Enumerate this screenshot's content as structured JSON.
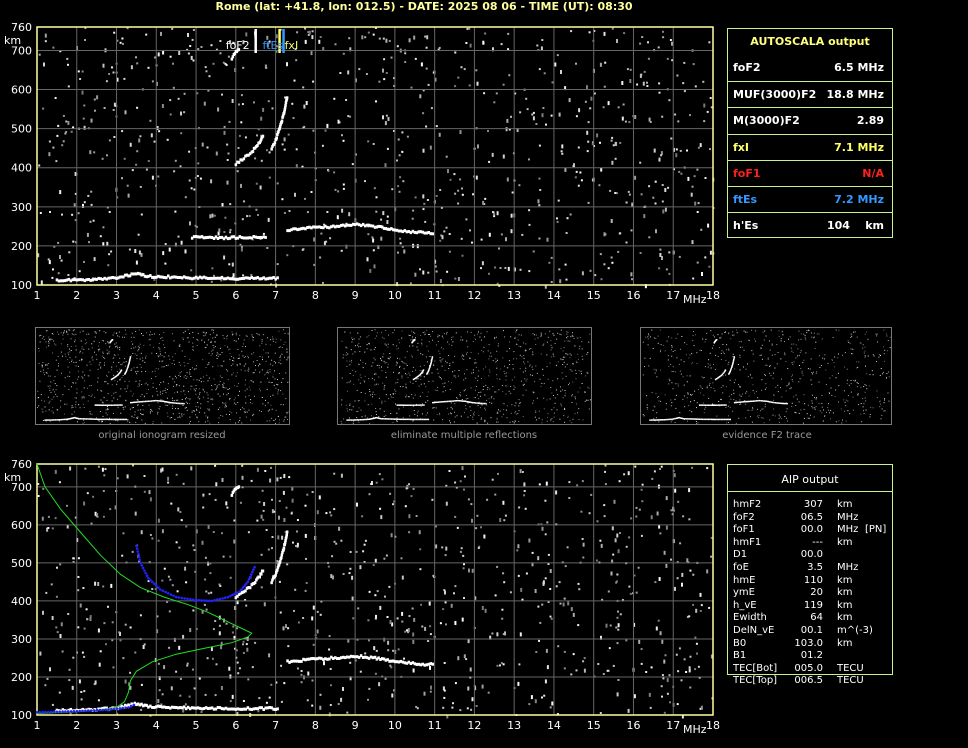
{
  "header": {
    "title": "Rome (lat: +41.8, lon: 012.5) - DATE: 2025 08 06 - TIME (UT): 08:30"
  },
  "autoscala": {
    "title": "AUTOSCALA output",
    "rows": [
      {
        "key": "foF2",
        "value": "6.5 MHz",
        "color": "#ffffff"
      },
      {
        "key": "MUF(3000)F2",
        "value": "18.8 MHz",
        "color": "#ffffff"
      },
      {
        "key": "M(3000)F2",
        "value": "2.89",
        "color": "#ffffff"
      },
      {
        "key": "fxI",
        "value": "7.1 MHz",
        "color": "#ffff66"
      },
      {
        "key": "foF1",
        "value": "N/A",
        "color": "#ff2020"
      },
      {
        "key": "ftEs",
        "value": "7.2 MHz",
        "color": "#3399ff"
      },
      {
        "key": "h'Es",
        "value": "104    km",
        "color": "#ffffff"
      }
    ]
  },
  "aip": {
    "title": "AIP output",
    "rows": [
      {
        "k": "hmF2",
        "v": "307",
        "u": "km",
        "x": ""
      },
      {
        "k": "foF2",
        "v": "06.5",
        "u": "MHz",
        "x": ""
      },
      {
        "k": "foF1",
        "v": "00.0",
        "u": "MHz",
        "x": "[PN]"
      },
      {
        "k": "hmF1",
        "v": "---",
        "u": "km",
        "x": ""
      },
      {
        "k": "D1",
        "v": "00.0",
        "u": "",
        "x": ""
      },
      {
        "k": "foE",
        "v": "3.5",
        "u": "MHz",
        "x": ""
      },
      {
        "k": "hmE",
        "v": "110",
        "u": "km",
        "x": ""
      },
      {
        "k": "ymE",
        "v": "20",
        "u": "km",
        "x": ""
      },
      {
        "k": "h_vE",
        "v": "119",
        "u": "km",
        "x": ""
      },
      {
        "k": "Ewidth",
        "v": "64",
        "u": "km",
        "x": ""
      },
      {
        "k": "DelN_vE",
        "v": "00.1",
        "u": "m^(-3)",
        "x": ""
      },
      {
        "k": "B0",
        "v": "103.0",
        "u": "km",
        "x": ""
      },
      {
        "k": "B1",
        "v": "01.2",
        "u": "",
        "x": ""
      },
      {
        "k": "TEC[Bot]",
        "v": "005.0",
        "u": "TECU",
        "x": ""
      },
      {
        "k": "TEC[Top]",
        "v": "006.5",
        "u": "TECU",
        "x": ""
      }
    ]
  },
  "thumbnails": [
    {
      "caption": "original ionogram resized"
    },
    {
      "caption": "eliminate multiple reflections"
    },
    {
      "caption": "evidence F2 trace"
    }
  ],
  "chart_data": [
    {
      "type": "scatter",
      "xlabel": "MHz",
      "ylabel": "km",
      "xlim": [
        1,
        18
      ],
      "ylim": [
        100,
        760
      ],
      "xticks": [
        "1",
        "2",
        "3",
        "4",
        "5",
        "6",
        "7",
        "8",
        "9",
        "10",
        "11",
        "12",
        "13",
        "14",
        "15",
        "16",
        "17",
        "18"
      ],
      "yticks": [
        "100",
        "200",
        "300",
        "400",
        "500",
        "600",
        "700",
        "760"
      ],
      "grid": true,
      "markers": [
        {
          "name": "foF2",
          "x": 6.5,
          "color": "#ffffff"
        },
        {
          "name": "ftEs",
          "x": 7.2,
          "color": "#3399ff"
        },
        {
          "name": "fxI",
          "x": 7.1,
          "color": "#ffff66"
        }
      ],
      "traces": [
        {
          "name": "E/Es",
          "points": [
            [
              1.5,
              112
            ],
            [
              2,
              113
            ],
            [
              2.5,
              115
            ],
            [
              3,
              118
            ],
            [
              3.3,
              125
            ],
            [
              3.5,
              130
            ],
            [
              3.8,
              122
            ],
            [
              4.5,
              120
            ],
            [
              5,
              118
            ],
            [
              6,
              117
            ],
            [
              7.1,
              117
            ]
          ]
        },
        {
          "name": "Es2",
          "points": [
            [
              4.9,
              222
            ],
            [
              5.5,
              221
            ],
            [
              6,
              221
            ],
            [
              6.8,
              223
            ]
          ]
        },
        {
          "name": "F2o",
          "points": [
            [
              6,
              410
            ],
            [
              6.2,
              425
            ],
            [
              6.4,
              440
            ],
            [
              6.6,
              465
            ],
            [
              6.7,
              485
            ]
          ]
        },
        {
          "name": "F2x",
          "points": [
            [
              6.9,
              450
            ],
            [
              7.0,
              470
            ],
            [
              7.1,
              500
            ],
            [
              7.2,
              535
            ],
            [
              7.3,
              585
            ]
          ]
        },
        {
          "name": "F2top",
          "points": [
            [
              5.9,
              680
            ],
            [
              6.0,
              695
            ],
            [
              6.1,
              705
            ]
          ]
        },
        {
          "name": "Esmulti",
          "points": [
            [
              7.3,
              240
            ],
            [
              7.8,
              245
            ],
            [
              8.5,
              250
            ],
            [
              9,
              255
            ],
            [
              9.5,
              250
            ],
            [
              10,
              240
            ],
            [
              10.5,
              235
            ],
            [
              11,
              232
            ]
          ]
        }
      ]
    },
    {
      "type": "line",
      "xlabel": "MHz",
      "ylabel": "km",
      "xlim": [
        1,
        18
      ],
      "ylim": [
        100,
        760
      ],
      "xticks": [
        "1",
        "2",
        "3",
        "4",
        "5",
        "6",
        "7",
        "8",
        "9",
        "10",
        "11",
        "12",
        "13",
        "14",
        "15",
        "16",
        "17",
        "18"
      ],
      "yticks": [
        "100",
        "200",
        "300",
        "400",
        "500",
        "600",
        "700",
        "760"
      ],
      "grid": true,
      "series": [
        {
          "name": "profile",
          "color": "#22dd22",
          "points": [
            [
              1.0,
              760
            ],
            [
              1.2,
              700
            ],
            [
              1.6,
              640
            ],
            [
              2.1,
              580
            ],
            [
              2.6,
              520
            ],
            [
              3.1,
              470
            ],
            [
              3.6,
              435
            ],
            [
              4.2,
              410
            ],
            [
              4.8,
              390
            ],
            [
              5.3,
              370
            ],
            [
              5.7,
              350
            ],
            [
              6.1,
              330
            ],
            [
              6.4,
              315
            ],
            [
              6.3,
              305
            ],
            [
              5.9,
              290
            ],
            [
              5.2,
              275
            ],
            [
              4.5,
              260
            ],
            [
              3.9,
              240
            ],
            [
              3.5,
              215
            ],
            [
              3.35,
              190
            ],
            [
              3.3,
              160
            ],
            [
              3.2,
              135
            ],
            [
              3.0,
              120
            ],
            [
              2.5,
              112
            ],
            [
              1.8,
              108
            ],
            [
              1.0,
              104
            ]
          ]
        },
        {
          "name": "fit",
          "color": "#2222ff",
          "points": [
            [
              3.5,
              545
            ],
            [
              3.6,
              500
            ],
            [
              3.8,
              460
            ],
            [
              4.1,
              430
            ],
            [
              4.5,
              410
            ],
            [
              5.0,
              402
            ],
            [
              5.4,
              400
            ],
            [
              5.8,
              410
            ],
            [
              6.1,
              425
            ],
            [
              6.3,
              450
            ],
            [
              6.5,
              495
            ]
          ]
        },
        {
          "name": "fitE",
          "color": "#2222ff",
          "points": [
            [
              1.0,
              107
            ],
            [
              2.0,
              110
            ],
            [
              2.8,
              114
            ],
            [
              3.3,
              120
            ],
            [
              3.5,
              130
            ]
          ]
        }
      ],
      "traces": [
        {
          "name": "E/Es",
          "points": [
            [
              1.5,
              112
            ],
            [
              2,
              113
            ],
            [
              2.5,
              115
            ],
            [
              3,
              118
            ],
            [
              3.3,
              125
            ],
            [
              3.5,
              130
            ],
            [
              3.8,
              122
            ],
            [
              4.5,
              120
            ],
            [
              5,
              118
            ],
            [
              6,
              117
            ],
            [
              7.1,
              117
            ]
          ]
        },
        {
          "name": "F2o",
          "points": [
            [
              6,
              410
            ],
            [
              6.2,
              425
            ],
            [
              6.4,
              440
            ],
            [
              6.6,
              465
            ],
            [
              6.7,
              485
            ]
          ]
        },
        {
          "name": "F2x",
          "points": [
            [
              6.9,
              450
            ],
            [
              7.0,
              470
            ],
            [
              7.1,
              500
            ],
            [
              7.2,
              535
            ],
            [
              7.3,
              585
            ]
          ]
        },
        {
          "name": "F2top",
          "points": [
            [
              5.9,
              680
            ],
            [
              6.0,
              695
            ],
            [
              6.1,
              705
            ]
          ]
        },
        {
          "name": "Esmulti",
          "points": [
            [
              7.3,
              240
            ],
            [
              7.8,
              245
            ],
            [
              8.5,
              250
            ],
            [
              9,
              255
            ],
            [
              9.5,
              250
            ],
            [
              10,
              240
            ],
            [
              10.5,
              235
            ],
            [
              11,
              232
            ]
          ]
        }
      ]
    }
  ]
}
